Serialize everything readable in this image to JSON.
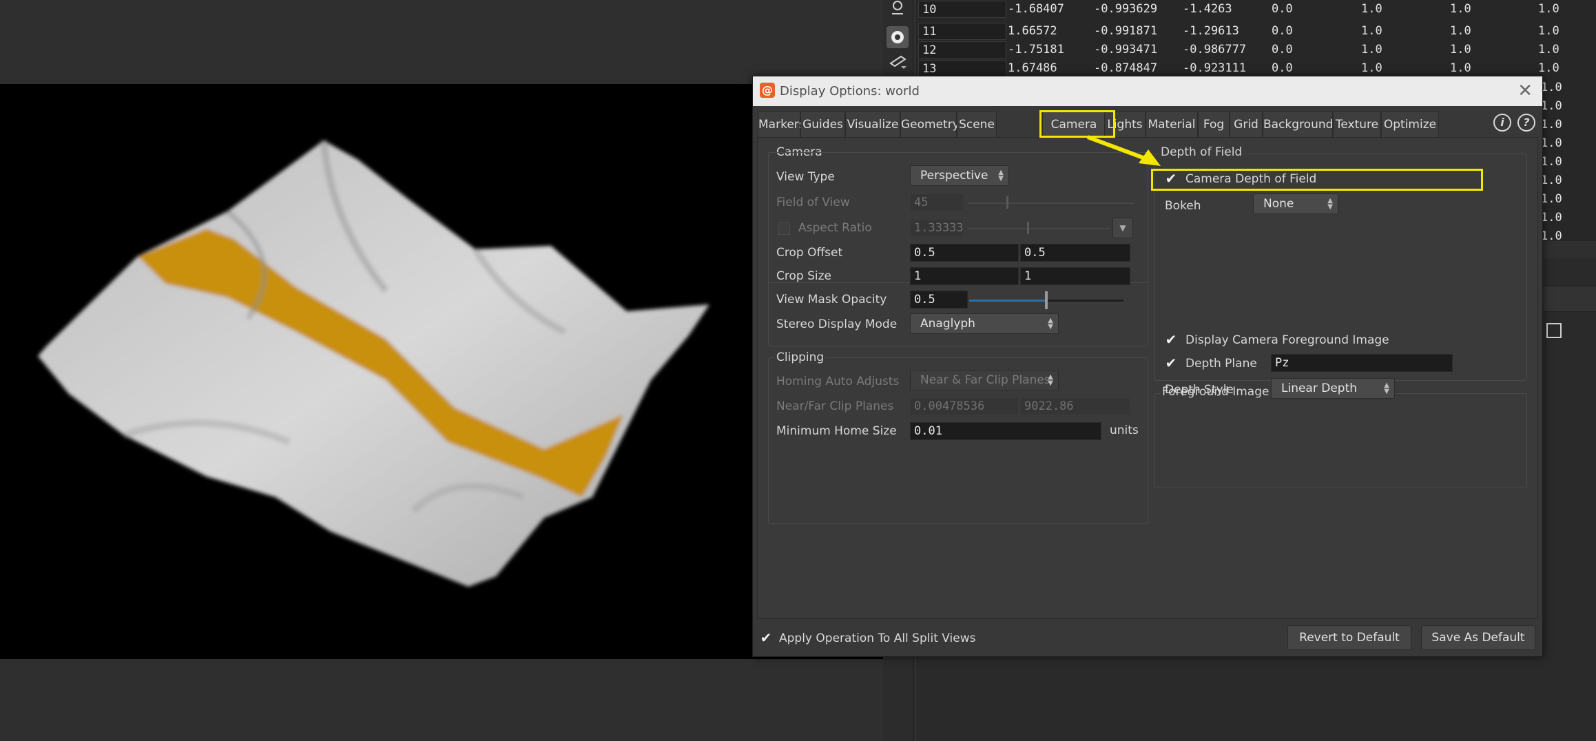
{
  "spreadsheet": {
    "rows": [
      {
        "idx": "10",
        "c1": "-1.68407",
        "c2": "-0.993629",
        "c3": "-1.4263",
        "c4": "0.0",
        "c5": "1.0",
        "c6": "1.0",
        "c7": "1.0"
      },
      {
        "idx": "11",
        "c1": "1.66572",
        "c2": "-0.991871",
        "c3": "-1.29613",
        "c4": "0.0",
        "c5": "1.0",
        "c6": "1.0",
        "c7": "1.0"
      },
      {
        "idx": "12",
        "c1": "-1.75181",
        "c2": "-0.993471",
        "c3": "-0.986777",
        "c4": "0.0",
        "c5": "1.0",
        "c6": "1.0",
        "c7": "1.0"
      },
      {
        "idx": "13",
        "c1": "1.67486",
        "c2": "-0.874847",
        "c3": "-0.923111",
        "c4": "0.0",
        "c5": "1.0",
        "c6": "1.0",
        "c7": "1.0"
      }
    ],
    "right_column_values": [
      "1.0",
      "1.0",
      "1.0",
      "1.0",
      "1.0",
      "1.0",
      "1.0",
      "1.0",
      "1.0"
    ]
  },
  "dialog": {
    "title": "Display Options:  world",
    "tabs": [
      "Markers",
      "Guides",
      "Visualize",
      "Geometry",
      "Scene",
      "Camera",
      "Lights",
      "Material",
      "Fog",
      "Grid",
      "Background",
      "Texture",
      "Optimize"
    ],
    "active_tab": "Camera",
    "camera": {
      "group_label": "Camera",
      "view_type_label": "View Type",
      "view_type_value": "Perspective",
      "fov_label": "Field of View",
      "fov_value": "45",
      "aspect_label": "Aspect Ratio",
      "aspect_value": "1.33333",
      "crop_offset_label": "Crop Offset",
      "crop_offset_x": "0.5",
      "crop_offset_y": "0.5",
      "crop_size_label": "Crop Size",
      "crop_size_x": "1",
      "crop_size_y": "1",
      "mask_opacity_label": "View Mask Opacity",
      "mask_opacity_value": "0.5",
      "mask_opacity_fraction": 0.5,
      "stereo_label": "Stereo Display Mode",
      "stereo_value": "Anaglyph"
    },
    "clipping": {
      "group_label": "Clipping",
      "homing_label": "Homing Auto Adjusts",
      "homing_value": "Near & Far Clip Planes",
      "near_far_label": "Near/Far Clip Planes",
      "near_value": "0.00478536",
      "far_value": "9022.86",
      "min_home_label": "Minimum Home Size",
      "min_home_value": "0.01",
      "min_home_units": "units"
    },
    "dof": {
      "group_label": "Depth of Field",
      "camera_dof_label": "Camera Depth of Field",
      "camera_dof_checked": true,
      "bokeh_label": "Bokeh",
      "bokeh_value": "None"
    },
    "foreground": {
      "group_label": "Foreground Image",
      "display_label": "Display Camera Foreground Image",
      "depth_plane_label": "Depth Plane",
      "depth_plane_value": "Pz",
      "depth_style_label": "Depth Style",
      "depth_style_value": "Linear Depth"
    },
    "footer": {
      "apply_label": "Apply Operation To All Split Views",
      "revert_label": "Revert to Default",
      "save_label": "Save As Default"
    }
  },
  "colors": {
    "highlight": "#f3e600",
    "cloth": "#d4d4d4",
    "stripe": "#c8900f",
    "slider_fill": "#2e6fa8"
  }
}
